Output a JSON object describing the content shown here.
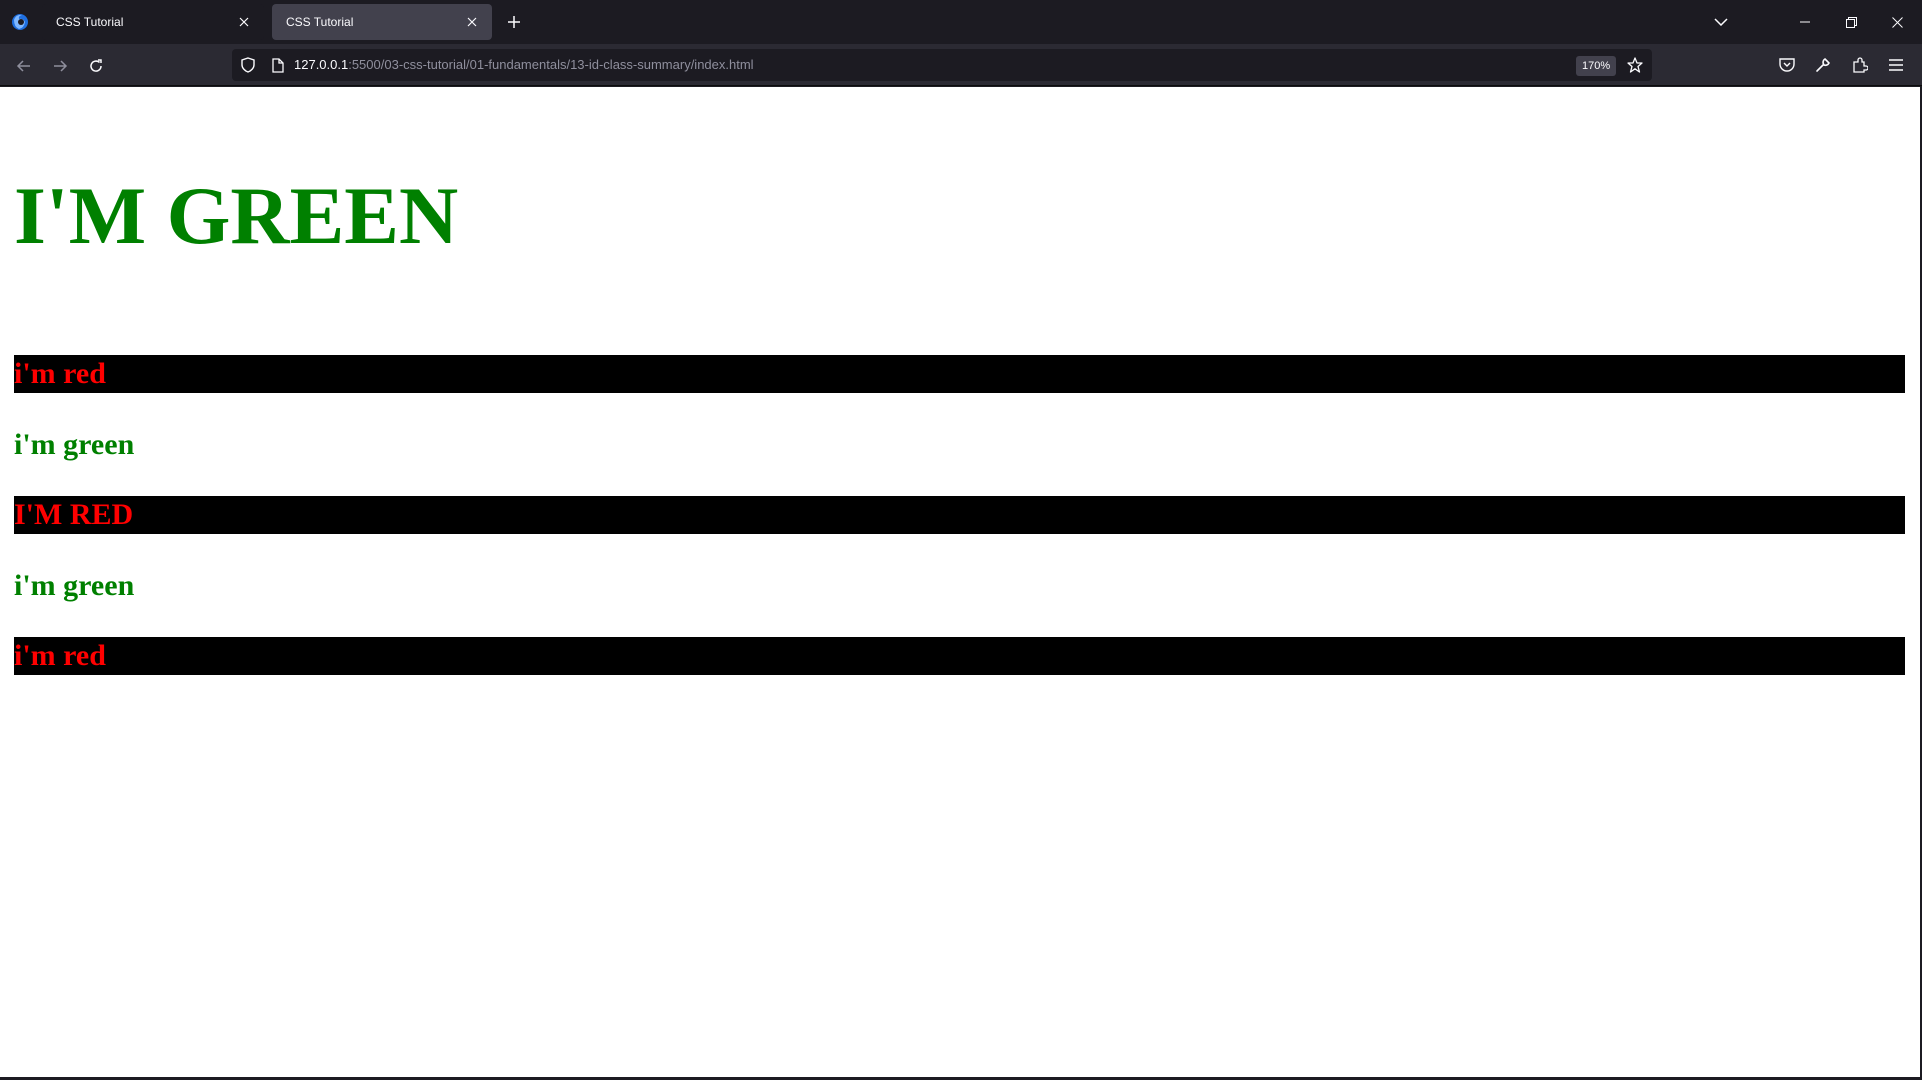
{
  "browser": {
    "tabs": [
      {
        "label": "CSS Tutorial",
        "active": false
      },
      {
        "label": "CSS Tutorial",
        "active": true
      }
    ],
    "url_host": "127.0.0.1",
    "url_rest": ":5500/03-css-tutorial/01-fundamentals/13-id-class-summary/index.html",
    "zoom": "170%"
  },
  "page": {
    "heading": "I'M GREEN",
    "items": [
      {
        "text": "i'm red",
        "style": "red"
      },
      {
        "text": "i'm green",
        "style": "green"
      },
      {
        "text": "I'M RED",
        "style": "red"
      },
      {
        "text": "i'm green",
        "style": "green"
      },
      {
        "text": "i'm red",
        "style": "red"
      }
    ]
  },
  "colors": {
    "green_text": "#008000",
    "red_text": "#ff0000",
    "red_row_background": "#000000"
  },
  "icons": [
    "firefox-logo-icon",
    "close-icon",
    "plus-icon",
    "chevron-down-icon",
    "minimize-icon",
    "restore-icon",
    "back-arrow-icon",
    "forward-arrow-icon",
    "reload-icon",
    "shield-icon",
    "page-icon",
    "star-icon",
    "pocket-icon",
    "wrench-icon",
    "extensions-icon",
    "hamburger-menu-icon"
  ]
}
